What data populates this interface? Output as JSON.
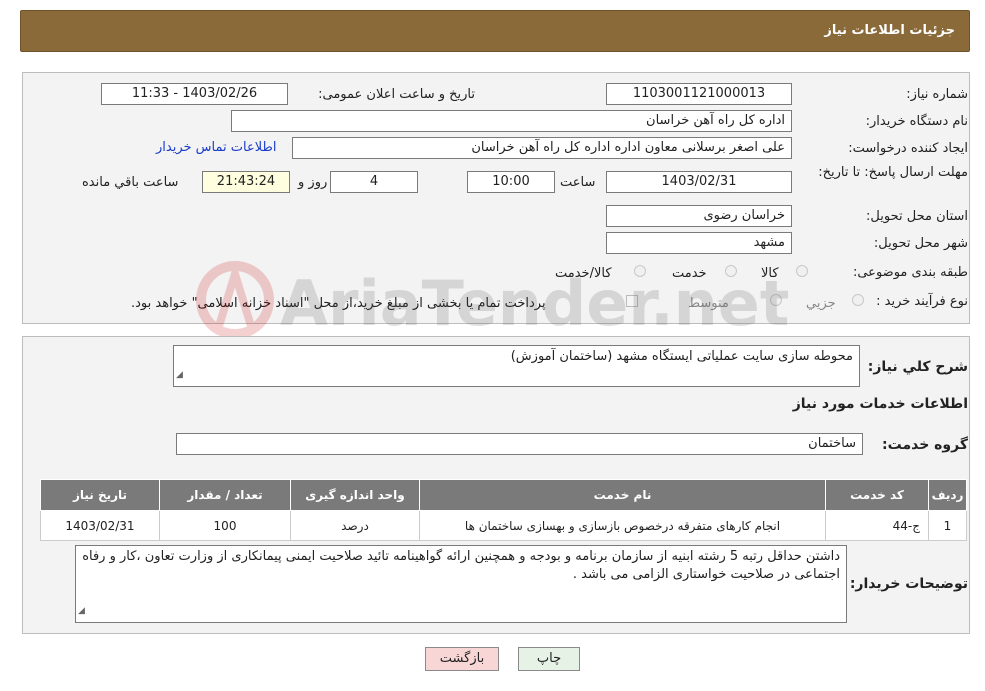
{
  "header": {
    "title": "جزئیات اطلاعات نیاز"
  },
  "form": {
    "need_number_label": "شماره نیاز:",
    "need_number": "1103001121000013",
    "announce_datetime_label": "تاریخ و ساعت اعلان عمومی:",
    "announce_datetime": "1403/02/26 - 11:33",
    "buyer_org_label": "نام دستگاه خریدار:",
    "buyer_org": "اداره کل راه آهن خراسان",
    "requester_label": "ایجاد کننده درخواست:",
    "requester": "علی اصغر برسلانی معاون اداره اداره کل راه آهن خراسان",
    "buyer_contact_link": "اطلاعات تماس خریدار",
    "deadline_label": "مهلت ارسال پاسخ: تا تاریخ:",
    "deadline_date": "1403/02/31",
    "time_label": "ساعت",
    "deadline_time": "10:00",
    "days_value": "4",
    "days_label": "روز و",
    "remaining_time": "21:43:24",
    "remaining_label": "ساعت باقي مانده",
    "province_label": "استان محل تحویل:",
    "province": "خراسان رضوی",
    "city_label": "شهر محل تحویل:",
    "city": "مشهد",
    "category_label": "طبقه بندی موضوعی:",
    "category_options": [
      "کالا",
      "خدمت",
      "کالا/خدمت"
    ],
    "process_label": "نوع فرآیند خرید :",
    "process_options": [
      "جزیي",
      "متوسط"
    ],
    "payment_note": "پرداخت تمام يا بخشی از مبلغ خريد،از محل \"اسناد خزانه اسلامی\" خواهد بود."
  },
  "details": {
    "summary_label": "شرح کلي نياز:",
    "summary": "محوطه سازی سایت عملیاتی ایستگاه مشهد (ساختمان آموزش)",
    "services_heading": "اطلاعات خدمات مورد نیاز",
    "service_group_label": "گروه خدمت:",
    "service_group": "ساختمان",
    "table": {
      "headers": [
        "ردیف",
        "کد خدمت",
        "نام خدمت",
        "واحد اندازه گیری",
        "تعداد / مقدار",
        "تاریخ نیاز"
      ],
      "rows": [
        [
          "1",
          "ج-44",
          "انجام کارهای متفرقه درخصوص بازسازی و بهسازی ساختمان ها",
          "درصد",
          "100",
          "1403/02/31"
        ]
      ]
    },
    "buyer_notes_label": "توضیحات خریدار:",
    "buyer_notes": "داشتن حداقل رتبه 5 رشته ابنیه از سازمان برنامه و بودجه و همچنین ارائه گواهینامه تائید صلاحیت ایمنی پیمانکاری از وزارت تعاون ،کار و رفاه اجتماعی در صلاحیت خواستاری الزامی می باشد ."
  },
  "buttons": {
    "print": "چاپ",
    "back": "بازگشت"
  },
  "watermark": {
    "text": "AriaTender.net"
  }
}
